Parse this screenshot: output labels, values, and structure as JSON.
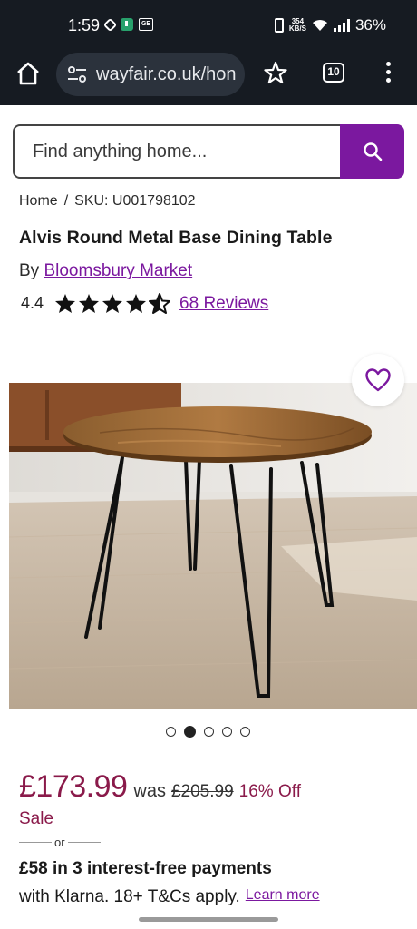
{
  "status_bar": {
    "time": "1:59",
    "net_speed_value": "354",
    "net_speed_unit": "KB/S",
    "battery": "36%"
  },
  "browser": {
    "url": "wayfair.co.uk/hon",
    "tab_count": "10"
  },
  "search": {
    "placeholder": "Find anything home..."
  },
  "breadcrumb": {
    "home": "Home",
    "separator": "/",
    "sku": "SKU: U001798102"
  },
  "product": {
    "title": "Alvis Round Metal Base Dining Table",
    "by_prefix": "By",
    "brand": "Bloomsbury Market",
    "rating": "4.4",
    "rating_value": 4.4,
    "rating_max": 5,
    "reviews": "68 Reviews"
  },
  "gallery": {
    "image_count": 5,
    "active_index": 1
  },
  "pricing": {
    "price": "£173.99",
    "was_label": "was",
    "old_price": "£205.99",
    "discount": "16% Off",
    "sale_label": "Sale",
    "or_label": "or",
    "klarna_headline": "£58 in 3 interest-free payments",
    "klarna_text": "with Klarna. 18+ T&Cs apply.",
    "learn_more": "Learn more"
  },
  "colors": {
    "brand_purple": "#7b189f",
    "price_red": "#8a1a4a",
    "toolbar_bg": "#161b22"
  },
  "icons": [
    "home-icon",
    "tune-icon",
    "star-icon",
    "tabs-icon",
    "more-vert-icon",
    "search-icon",
    "heart-icon",
    "star-filled-icon",
    "star-half-icon"
  ]
}
